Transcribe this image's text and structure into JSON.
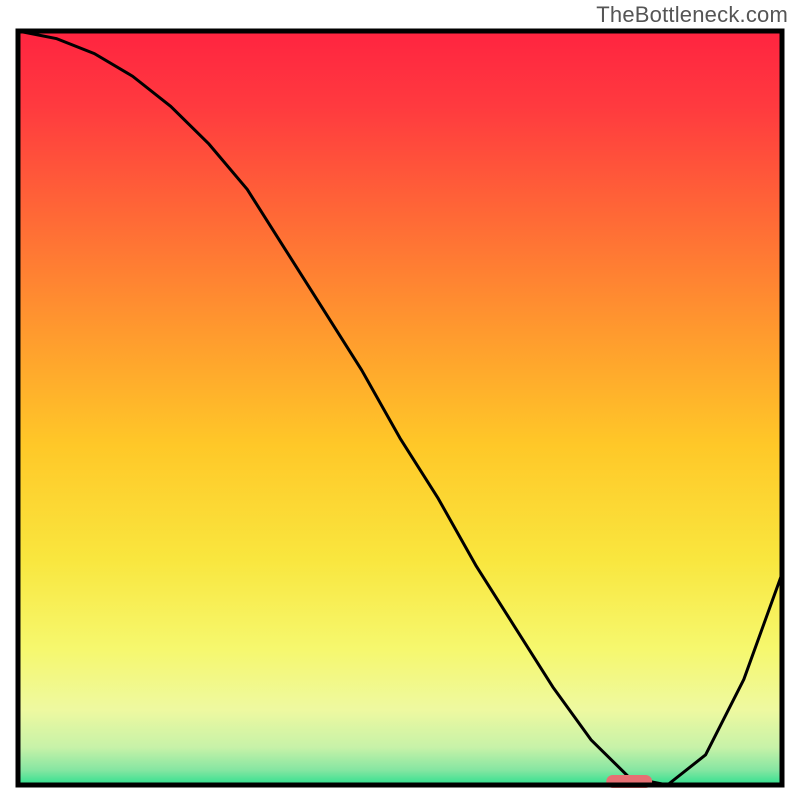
{
  "watermark": "TheBottleneck.com",
  "chart_data": {
    "type": "line",
    "title": "",
    "xlabel": "",
    "ylabel": "",
    "xlim": [
      0,
      100
    ],
    "ylim": [
      0,
      100
    ],
    "x": [
      0,
      5,
      10,
      15,
      20,
      25,
      30,
      35,
      40,
      45,
      50,
      55,
      60,
      65,
      70,
      75,
      80,
      85,
      90,
      95,
      100
    ],
    "values": [
      100,
      99,
      97,
      94,
      90,
      85,
      79,
      71,
      63,
      55,
      46,
      38,
      29,
      21,
      13,
      6,
      1,
      0,
      4,
      14,
      28
    ],
    "series": [
      {
        "name": "bottleneck-curve",
        "x": [
          0,
          5,
          10,
          15,
          20,
          25,
          30,
          35,
          40,
          45,
          50,
          55,
          60,
          65,
          70,
          75,
          80,
          85,
          90,
          95,
          100
        ],
        "values": [
          100,
          99,
          97,
          94,
          90,
          85,
          79,
          71,
          63,
          55,
          46,
          38,
          29,
          21,
          13,
          6,
          1,
          0,
          4,
          14,
          28
        ]
      }
    ],
    "highlight_segment": {
      "x_start": 77,
      "x_end": 83,
      "y": 0,
      "color": "#e76f73"
    },
    "gradient_stops": [
      {
        "offset": 0.0,
        "color": "#ff2440"
      },
      {
        "offset": 0.1,
        "color": "#ff3a3f"
      },
      {
        "offset": 0.25,
        "color": "#ff6a36"
      },
      {
        "offset": 0.4,
        "color": "#ff9a2e"
      },
      {
        "offset": 0.55,
        "color": "#ffc828"
      },
      {
        "offset": 0.7,
        "color": "#f9e63e"
      },
      {
        "offset": 0.82,
        "color": "#f6f86e"
      },
      {
        "offset": 0.9,
        "color": "#eef9a0"
      },
      {
        "offset": 0.95,
        "color": "#c7f2a8"
      },
      {
        "offset": 0.98,
        "color": "#86e6a2"
      },
      {
        "offset": 1.0,
        "color": "#2fe08f"
      }
    ],
    "frame_color": "#000000",
    "line_color": "#000000"
  }
}
